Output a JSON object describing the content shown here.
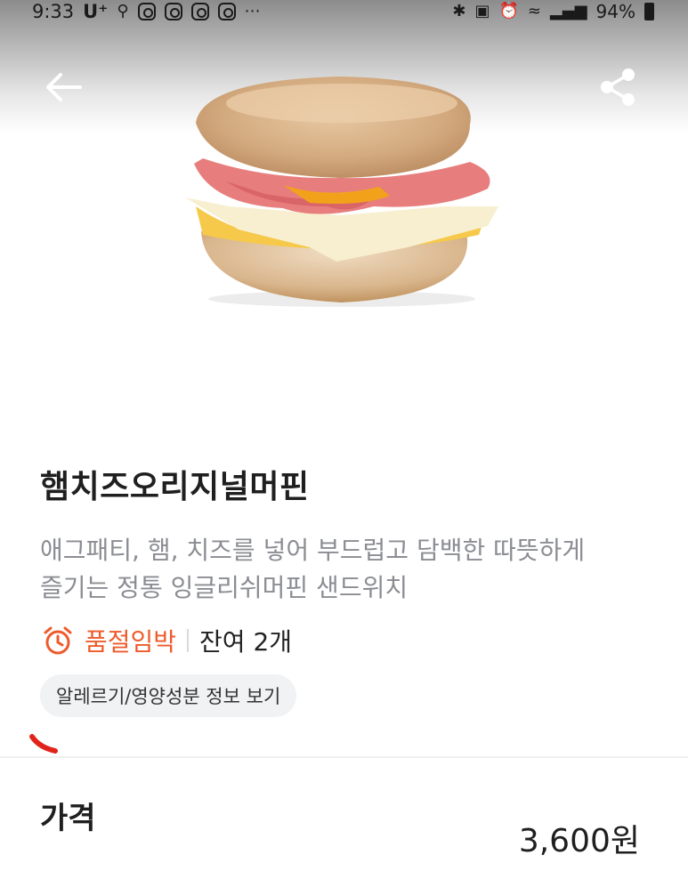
{
  "status_bar": {
    "time": "9:33",
    "carrier": "U⁺",
    "battery": "94%"
  },
  "toolbar": {
    "back_icon": "arrow-left-icon",
    "share_icon": "share-icon"
  },
  "product": {
    "title": "햄치즈오리지널머핀",
    "description_lines": [
      "애그패티, 햄, 치즈를 넣어 부드럽고 담백한 따뜻하게",
      "즐기는 정통 잉글리쉬머핀 샌드위치"
    ],
    "stock_status": "품절임박",
    "remaining": "잔여 2개",
    "allergy_button": "알레르기/영양성분 정보 보기"
  },
  "price": {
    "label": "가격",
    "value": "3,600원"
  },
  "colors": {
    "accent": "#ee5b2b",
    "description": "#8b8d93",
    "chip_bg": "#f1f2f4"
  }
}
